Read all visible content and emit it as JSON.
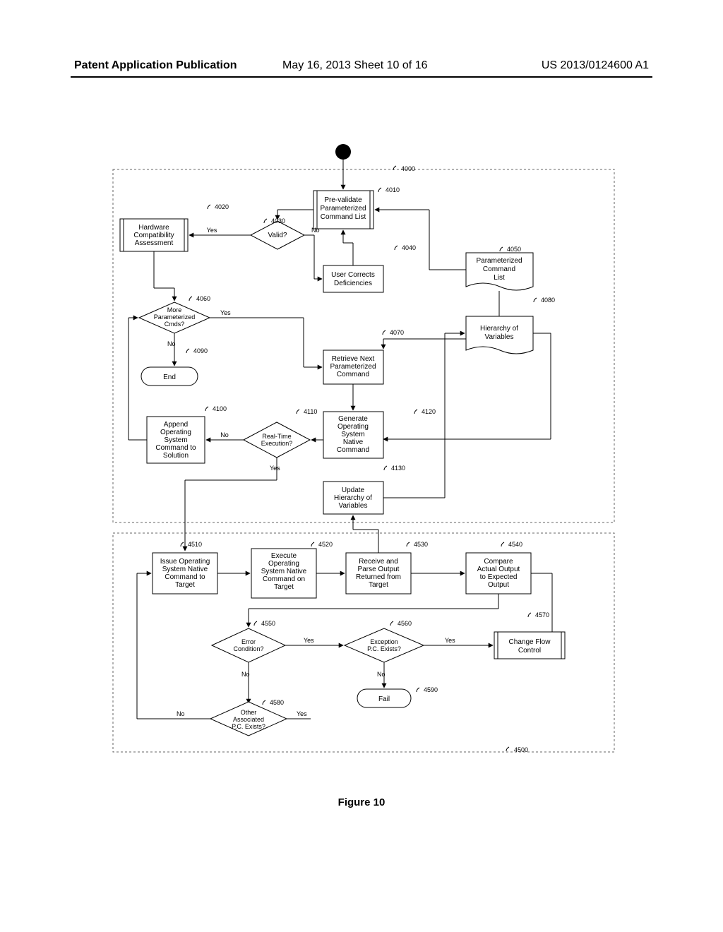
{
  "header": {
    "left": "Patent Application Publication",
    "mid": "May 16, 2013  Sheet 10 of 16",
    "right": "US 2013/0124600 A1"
  },
  "figure_label": "Figure 10",
  "labels": {
    "n4000": "4000",
    "n4010": "4010",
    "n4020": "4020",
    "n4030": "4030",
    "n4040": "4040",
    "n4050": "4050",
    "n4060": "4060",
    "n4070": "4070",
    "n4080": "4080",
    "n4090": "4090",
    "n4100": "4100",
    "n4110": "4110",
    "n4120": "4120",
    "n4130": "4130",
    "n4500": "4500",
    "n4510": "4510",
    "n4520": "4520",
    "n4530": "4530",
    "n4540": "4540",
    "n4550": "4550",
    "n4560": "4560",
    "n4570": "4570",
    "n4580": "4580",
    "n4590": "4590"
  },
  "text": {
    "prevalidate_l1": "Pre-validate",
    "prevalidate_l2": "Parameterized",
    "prevalidate_l3": "Command List",
    "hca_l1": "Hardware",
    "hca_l2": "Compatibility",
    "hca_l3": "Assessment",
    "valid": "Valid?",
    "correct_l1": "User Corrects",
    "correct_l2": "Deficiencies",
    "pcl_l1": "Parameterized",
    "pcl_l2": "Command",
    "pcl_l3": "List",
    "hov_l1": "Hierarchy of",
    "hov_l2": "Variables",
    "more_l1": "More",
    "more_l2": "Parameterized",
    "more_l3": "Cmds?",
    "retrieve_l1": "Retrieve Next",
    "retrieve_l2": "Parameterized",
    "retrieve_l3": "Command",
    "end": "End",
    "append_l1": "Append",
    "append_l2": "Operating",
    "append_l3": "System",
    "append_l4": "Command to",
    "append_l5": "Solution",
    "rte_l1": "Real-Time",
    "rte_l2": "Execution?",
    "gen_l1": "Generate",
    "gen_l2": "Operating",
    "gen_l3": "System",
    "gen_l4": "Native",
    "gen_l5": "Command",
    "upd_l1": "Update",
    "upd_l2": "Hierarchy of",
    "upd_l3": "Variables",
    "issue_l1": "Issue Operating",
    "issue_l2": "System Native",
    "issue_l3": "Command to",
    "issue_l4": "Target",
    "exec_l1": "Execute",
    "exec_l2": "Operating",
    "exec_l3": "System Native",
    "exec_l4": "Command on",
    "exec_l5": "Target",
    "recv_l1": "Receive and",
    "recv_l2": "Parse Output",
    "recv_l3": "Returned from",
    "recv_l4": "Target",
    "comp_l1": "Compare",
    "comp_l2": "Actual Output",
    "comp_l3": "to Expected",
    "comp_l4": "Output",
    "err_l1": "Error",
    "err_l2": "Condition?",
    "exc_l1": "Exception",
    "exc_l2": "P.C. Exists?",
    "cfc_l1": "Change Flow",
    "cfc_l2": "Control",
    "fail": "Fail",
    "other_l1": "Other",
    "other_l2": "Associated",
    "other_l3": "P.C. Exists?",
    "yes": "Yes",
    "no": "No"
  }
}
